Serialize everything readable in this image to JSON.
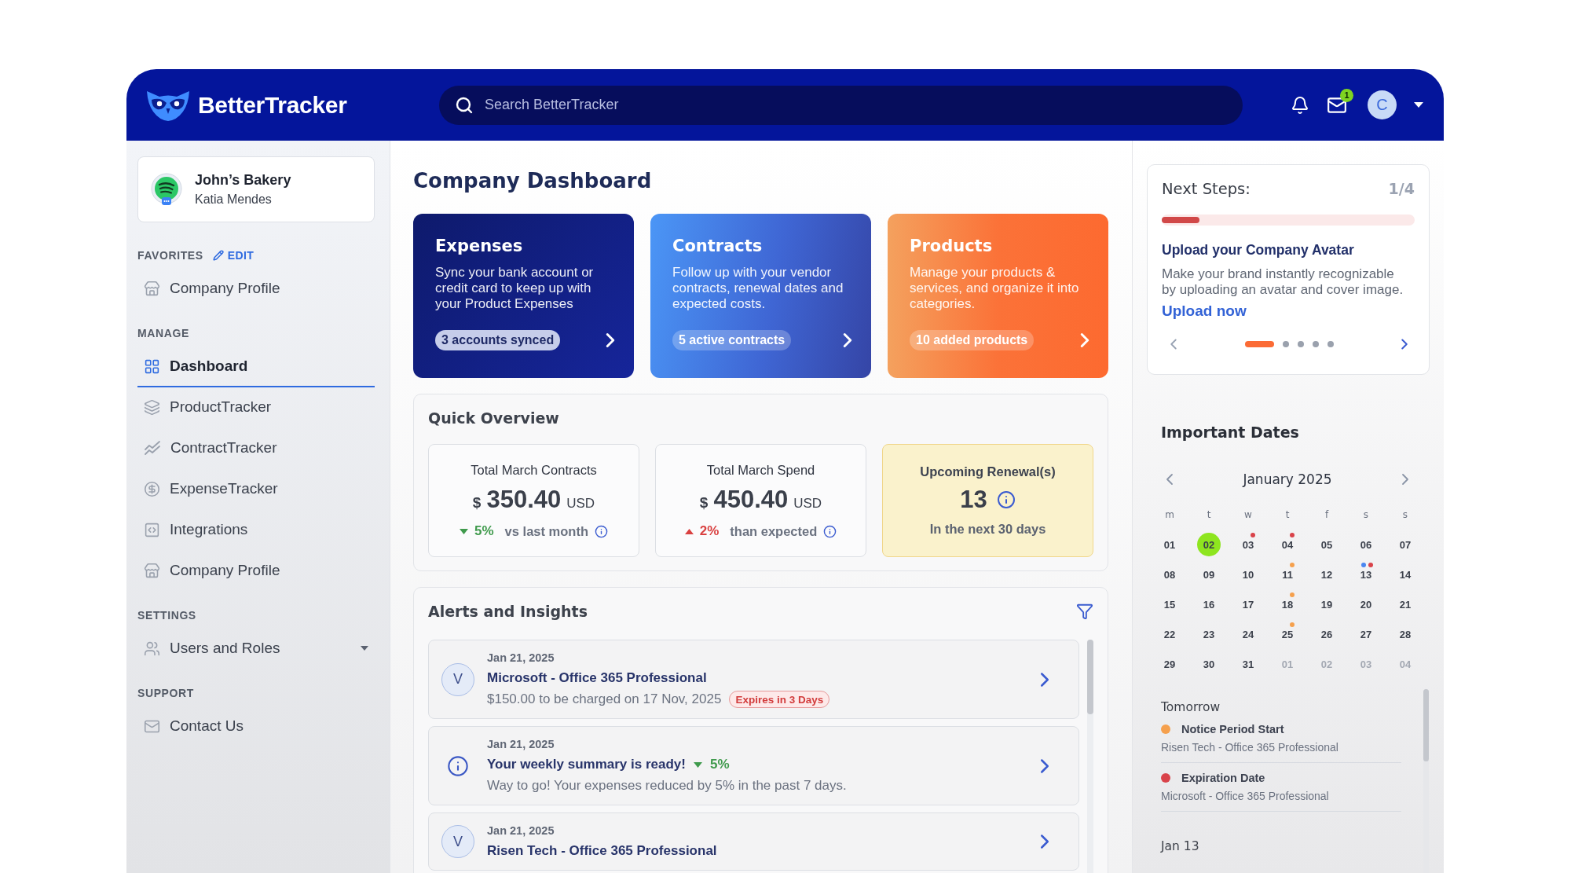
{
  "header": {
    "logo": "BetterTracker",
    "search": {
      "placeholder": "Search BetterTracker"
    },
    "mail_badge": "1",
    "avatar": "C"
  },
  "sidebar": {
    "company": {
      "name": "John’s Bakery",
      "user": "Katia Mendes"
    },
    "sections": [
      {
        "title": "FAVORITES",
        "action": "EDIT",
        "items": [
          {
            "label": "Company Profile",
            "selected": false
          }
        ]
      },
      {
        "title": "MANAGE",
        "items": [
          {
            "label": "Dashboard",
            "selected": true
          },
          {
            "label": "ProductTracker",
            "selected": false
          },
          {
            "label": "ContractTracker",
            "selected": false
          },
          {
            "label": "ExpenseTracker",
            "selected": false
          },
          {
            "label": "Integrations",
            "selected": false
          },
          {
            "label": "Company Profile",
            "selected": false
          }
        ]
      },
      {
        "title": "SETTINGS",
        "items": [
          {
            "label": "Users and Roles",
            "selected": false,
            "expanded": false
          }
        ]
      },
      {
        "title": "SUPPORT",
        "items": [
          {
            "label": "Contact Us",
            "selected": false
          }
        ]
      }
    ]
  },
  "page_title": "Company Dashboard",
  "feature_cards": [
    {
      "title": "Expenses",
      "text": "Sync your bank account or credit card to keep up with your Product Expenses",
      "badge": "3 accounts synced"
    },
    {
      "title": "Contracts",
      "text": "Follow up with your vendor contracts, renewal dates and expected costs.",
      "badge": "5 active contracts"
    },
    {
      "title": "Products",
      "text": "Manage your products & services, and organize it into categories.",
      "badge": "10 added products"
    }
  ],
  "overview": {
    "title": "Quick Overview",
    "stats": [
      {
        "kind": "amount",
        "label": "Total March Contracts",
        "currency": "$",
        "value": "350.40",
        "unit": "USD",
        "rising": false,
        "change": "5%",
        "note": "vs last month"
      },
      {
        "kind": "amount",
        "label": "Total March Spend",
        "currency": "$",
        "value": "450.40",
        "unit": "USD",
        "rising": true,
        "change": "2%",
        "note": "than expected"
      },
      {
        "kind": "count",
        "label": "Upcoming Renewal(s)",
        "value": "13",
        "note": "In the next 30 days"
      }
    ]
  },
  "alerts": {
    "title": "Alerts and Insights",
    "items": [
      {
        "kind": "vendor",
        "initial": "V",
        "date": "Jan 21, 2025",
        "title": "Microsoft - Office 365 Professional",
        "detail": "$150.00 to be charged on 17 Nov, 2025",
        "badge": "Expires in 3 Days"
      },
      {
        "kind": "info",
        "date": "Jan 21, 2025",
        "title": "Your weekly summary is ready!",
        "rising": false,
        "change": "5%",
        "detail": "Way to go! Your expenses reduced by 5% in the past 7 days."
      },
      {
        "kind": "vendor",
        "initial": "V",
        "date": "Jan 21, 2025",
        "title": "Risen Tech - Office 365 Professional"
      }
    ]
  },
  "next_steps": {
    "title": "Next Steps:",
    "counter": "1/4",
    "level": 0.15,
    "heading": "Upload your Company Avatar",
    "text": "Make your brand instantly recognizable by uploading an avatar and cover image.",
    "link": "Upload now",
    "pages": [
      {
        "selected": true
      },
      {
        "selected": false
      },
      {
        "selected": false
      },
      {
        "selected": false
      },
      {
        "selected": false
      }
    ]
  },
  "important_dates": {
    "title": "Important Dates",
    "calendar": {
      "month": "January 2025",
      "weekdays": [
        "m",
        "t",
        "w",
        "t",
        "f",
        "s",
        "s"
      ],
      "days": [
        {
          "label": "01",
          "selected": false,
          "other_month": false
        },
        {
          "label": "02",
          "selected": true,
          "other_month": false
        },
        {
          "label": "03",
          "selected": false,
          "other_month": false,
          "dots": [
            {
              "color": "#d9434a"
            }
          ]
        },
        {
          "label": "04",
          "selected": false,
          "other_month": false,
          "dots": [
            {
              "color": "#d9434a"
            }
          ]
        },
        {
          "label": "05",
          "selected": false,
          "other_month": false
        },
        {
          "label": "06",
          "selected": false,
          "other_month": false
        },
        {
          "label": "07",
          "selected": false,
          "other_month": false
        },
        {
          "label": "08",
          "selected": false,
          "other_month": false
        },
        {
          "label": "09",
          "selected": false,
          "other_month": false
        },
        {
          "label": "10",
          "selected": false,
          "other_month": false
        },
        {
          "label": "11",
          "selected": false,
          "other_month": false,
          "dots": [
            {
              "color": "#f5a04d"
            }
          ]
        },
        {
          "label": "12",
          "selected": false,
          "other_month": false
        },
        {
          "label": "13",
          "selected": false,
          "other_month": false,
          "dots": [
            {
              "color": "#4a86f0"
            },
            {
              "color": "#d9434a"
            }
          ]
        },
        {
          "label": "14",
          "selected": false,
          "other_month": false
        },
        {
          "label": "15",
          "selected": false,
          "other_month": false
        },
        {
          "label": "16",
          "selected": false,
          "other_month": false
        },
        {
          "label": "17",
          "selected": false,
          "other_month": false
        },
        {
          "label": "18",
          "selected": false,
          "other_month": false,
          "dots": [
            {
              "color": "#f5a04d"
            }
          ]
        },
        {
          "label": "19",
          "selected": false,
          "other_month": false
        },
        {
          "label": "20",
          "selected": false,
          "other_month": false
        },
        {
          "label": "21",
          "selected": false,
          "other_month": false
        },
        {
          "label": "22",
          "selected": false,
          "other_month": false
        },
        {
          "label": "23",
          "selected": false,
          "other_month": false
        },
        {
          "label": "24",
          "selected": false,
          "other_month": false
        },
        {
          "label": "25",
          "selected": false,
          "other_month": false,
          "dots": [
            {
              "color": "#f5a04d"
            }
          ]
        },
        {
          "label": "26",
          "selected": false,
          "other_month": false
        },
        {
          "label": "27",
          "selected": false,
          "other_month": false
        },
        {
          "label": "28",
          "selected": false,
          "other_month": false
        },
        {
          "label": "29",
          "selected": false,
          "other_month": false
        },
        {
          "label": "30",
          "selected": false,
          "other_month": false
        },
        {
          "label": "31",
          "selected": false,
          "other_month": false
        },
        {
          "label": "01",
          "selected": false,
          "other_month": true
        },
        {
          "label": "02",
          "selected": false,
          "other_month": true
        },
        {
          "label": "03",
          "selected": false,
          "other_month": true
        },
        {
          "label": "04",
          "selected": false,
          "other_month": true
        }
      ]
    },
    "groups": [
      {
        "title": "Tomorrow",
        "events": [
          {
            "title": "Notice Period Start",
            "subtitle": "Risen Tech - Office 365 Professional",
            "color": "#f5a04d"
          },
          {
            "title": "Expiration Date",
            "subtitle": "Microsoft - Office 365 Professional",
            "color": "#d9434a"
          }
        ]
      },
      {
        "title": "Jan 13"
      }
    ]
  }
}
